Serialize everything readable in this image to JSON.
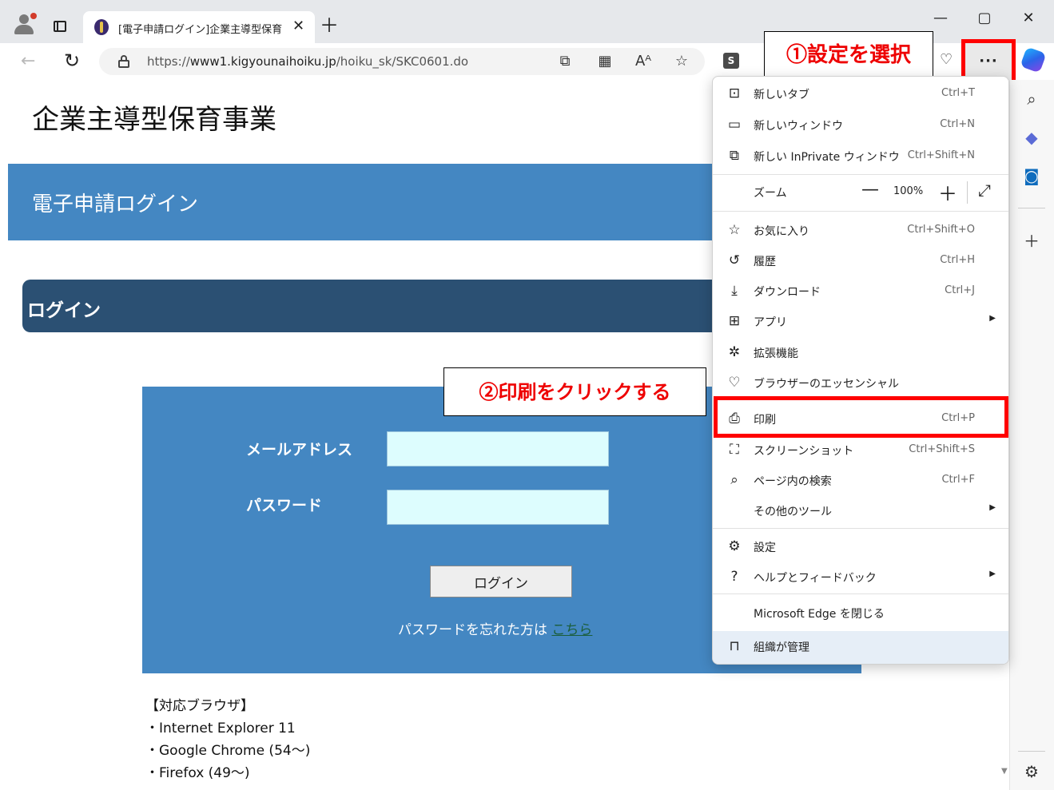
{
  "browser": {
    "tab_title": "[電子申請ログイン]企業主導型保育",
    "tab_close": "✕",
    "new_tab": "＋",
    "window_minimize": "—",
    "window_maximize": "▢",
    "window_close": "✕",
    "url_prefix": "https://",
    "url_host": "www1.kigyounaihoiku.jp",
    "url_path": "/hoiku_sk/SKC0601.do",
    "more_label": "···",
    "extension_s": "S"
  },
  "annotations": {
    "step1": "①設定を選択",
    "step2": "②印刷をクリックする"
  },
  "page": {
    "site_title": "企業主導型保育事業",
    "banner_title": "電子申請ログイン",
    "login_header": "ログイン",
    "email_label": "メールアドレス",
    "password_label": "パスワード",
    "email_value": "",
    "password_value": "",
    "login_button": "ログイン",
    "forgot_text": "パスワードを忘れた方は",
    "forgot_link": "こちら",
    "browsers_heading": "【対応ブラウザ】",
    "browsers": [
      "・Internet Explorer 11",
      "・Google Chrome (54～)",
      "・Firefox (49～)"
    ]
  },
  "menu": {
    "new_tab": {
      "label": "新しいタブ",
      "shortcut": "Ctrl+T"
    },
    "new_window": {
      "label": "新しいウィンドウ",
      "shortcut": "Ctrl+N"
    },
    "inprivate": {
      "label": "新しい InPrivate ウィンドウ",
      "shortcut": "Ctrl+Shift+N"
    },
    "zoom": {
      "label": "ズーム",
      "value": "100%",
      "minus": "—",
      "plus": "＋"
    },
    "favorites": {
      "label": "お気に入り",
      "shortcut": "Ctrl+Shift+O"
    },
    "history": {
      "label": "履歴",
      "shortcut": "Ctrl+H"
    },
    "downloads": {
      "label": "ダウンロード",
      "shortcut": "Ctrl+J"
    },
    "apps": {
      "label": "アプリ"
    },
    "extensions": {
      "label": "拡張機能"
    },
    "essentials": {
      "label": "ブラウザーのエッセンシャル"
    },
    "print": {
      "label": "印刷",
      "shortcut": "Ctrl+P"
    },
    "screenshot": {
      "label": "スクリーンショット",
      "shortcut": "Ctrl+Shift+S"
    },
    "find": {
      "label": "ページ内の検索",
      "shortcut": "Ctrl+F"
    },
    "more_tools": {
      "label": "その他のツール"
    },
    "settings": {
      "label": "設定"
    },
    "help": {
      "label": "ヘルプとフィードバック"
    },
    "close_edge": {
      "label": "Microsoft Edge を閉じる"
    },
    "managed": {
      "label": "組織が管理"
    }
  },
  "colors": {
    "banner": "#4487c2",
    "login_header": "#2b5073",
    "annotation_red": "#ff0000",
    "input_bg": "#ddfdfe"
  },
  "icons": [
    "profile-icon",
    "tab-actions-icon",
    "back-icon",
    "refresh-icon",
    "lock-icon",
    "read-aloud-icon",
    "favorite-star-icon",
    "copilot-icon",
    "search-icon",
    "add-icon",
    "sidebar-settings-icon",
    "print-icon"
  ]
}
